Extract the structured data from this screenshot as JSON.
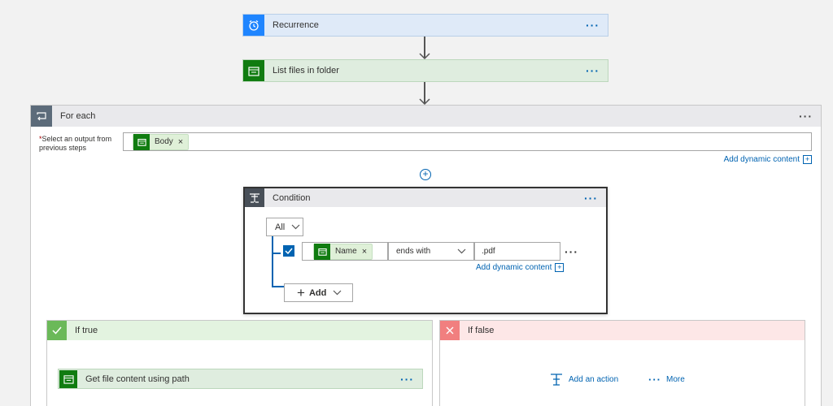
{
  "recurrence": {
    "title": "Recurrence",
    "menu_icon": "ellipsis-icon"
  },
  "list_files": {
    "title": "List files in folder"
  },
  "for_each": {
    "title": "For each",
    "field_label_line1": "Select an output from",
    "field_label_line2": "previous steps",
    "required_marker": "*",
    "token_label": "Body",
    "add_dynamic_content": "Add dynamic content"
  },
  "condition": {
    "title": "Condition",
    "group_operator": "All",
    "row": {
      "token_label": "Name",
      "operator": "ends with",
      "value": ".pdf",
      "add_dynamic_content": "Add dynamic content"
    },
    "add_button": "Add"
  },
  "if_true": {
    "title": "If true",
    "action": {
      "title": "Get file content using path"
    }
  },
  "if_false": {
    "title": "If false",
    "add_action": "Add an action",
    "more": "More"
  },
  "colors": {
    "recurrence_header": "#dfeaf8",
    "recurrence_icon": "#1f85ff",
    "sharepoint_header": "#dfeddf",
    "sharepoint_icon": "#107c10",
    "foreach_header": "#e9e9ec",
    "foreach_icon": "#5c6b7a",
    "condition_icon": "#484f58",
    "true_header": "#e3f3e0",
    "true_icon": "#6bb959",
    "false_header": "#fde7e7",
    "false_icon": "#f17f7f",
    "link": "#0063b1"
  }
}
